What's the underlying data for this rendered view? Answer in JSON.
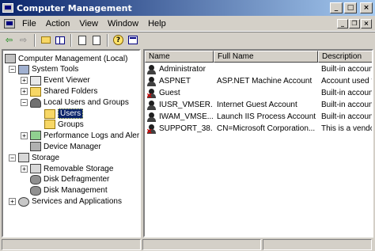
{
  "window": {
    "title": "Computer Management",
    "minimize": "_",
    "maximize": "□",
    "close": "×"
  },
  "menu": {
    "items": [
      "File",
      "Action",
      "View",
      "Window",
      "Help"
    ],
    "mdi_minimize": "_",
    "mdi_restore": "❐",
    "mdi_close": "×"
  },
  "toolbar": {
    "back": "⇦",
    "forward": "⇨"
  },
  "tree": {
    "items": [
      {
        "label": "Computer Management (Local)",
        "expander": "",
        "icon": "computer-icon",
        "level": 0
      },
      {
        "label": "System Tools",
        "expander": "−",
        "icon": "system-tools-icon",
        "level": 1
      },
      {
        "label": "Event Viewer",
        "expander": "+",
        "icon": "event-viewer-icon",
        "level": 2
      },
      {
        "label": "Shared Folders",
        "expander": "+",
        "icon": "shared-folders-icon",
        "level": 2
      },
      {
        "label": "Local Users and Groups",
        "expander": "−",
        "icon": "users-groups-icon",
        "level": 2
      },
      {
        "label": "Users",
        "expander": "",
        "icon": "folder-icon",
        "level": 3,
        "selected": true
      },
      {
        "label": "Groups",
        "expander": "",
        "icon": "folder-icon",
        "level": 3
      },
      {
        "label": "Performance Logs and Alerts",
        "expander": "+",
        "icon": "performance-icon",
        "level": 2
      },
      {
        "label": "Device Manager",
        "expander": "",
        "icon": "device-manager-icon",
        "level": 2
      },
      {
        "label": "Storage",
        "expander": "−",
        "icon": "storage-icon",
        "level": 1
      },
      {
        "label": "Removable Storage",
        "expander": "+",
        "icon": "removable-storage-icon",
        "level": 2
      },
      {
        "label": "Disk Defragmenter",
        "expander": "",
        "icon": "defragmenter-icon",
        "level": 2
      },
      {
        "label": "Disk Management",
        "expander": "",
        "icon": "disk-management-icon",
        "level": 2
      },
      {
        "label": "Services and Applications",
        "expander": "+",
        "icon": "services-icon",
        "level": 1
      }
    ]
  },
  "list": {
    "columns": [
      "Name",
      "Full Name",
      "Description"
    ],
    "rows": [
      {
        "name": "Administrator",
        "full_name": "",
        "description": "Built-in account",
        "disabled": false
      },
      {
        "name": "ASPNET",
        "full_name": "ASP.NET Machine Account",
        "description": "Account used f",
        "disabled": false
      },
      {
        "name": "Guest",
        "full_name": "",
        "description": "Built-in account",
        "disabled": true
      },
      {
        "name": "IUSR_VMSER...",
        "full_name": "Internet Guest Account",
        "description": "Built-in account",
        "disabled": false
      },
      {
        "name": "IWAM_VMSE...",
        "full_name": "Launch IIS Process Account",
        "description": "Built-in account",
        "disabled": false
      },
      {
        "name": "SUPPORT_38...",
        "full_name": "CN=Microsoft Corporation...",
        "description": "This is a vendor",
        "disabled": true
      }
    ]
  },
  "colors": {
    "title_start": "#0a246a",
    "title_end": "#a6caf0",
    "selection": "#0a246a",
    "face": "#d4d0c8"
  }
}
